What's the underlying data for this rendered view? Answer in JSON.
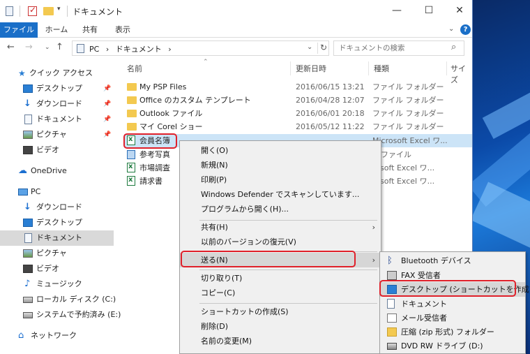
{
  "window": {
    "title": "ドキュメント"
  },
  "ribbon": {
    "tabs": [
      "ファイル",
      "ホーム",
      "共有",
      "表示"
    ]
  },
  "address": {
    "crumbs": [
      "PC",
      "›",
      "ドキュメント",
      "›"
    ],
    "search_placeholder": "ドキュメントの検索"
  },
  "nav": {
    "items": [
      {
        "label": "クイック アクセス",
        "icon": "star-icon"
      },
      {
        "label": "デスクトップ",
        "icon": "desktop-icon"
      },
      {
        "label": "ダウンロード",
        "icon": "download-icon"
      },
      {
        "label": "ドキュメント",
        "icon": "document-icon"
      },
      {
        "label": "ピクチャ",
        "icon": "pictures-icon"
      },
      {
        "label": "ビデオ",
        "icon": "video-icon"
      },
      {
        "label": "OneDrive",
        "icon": "cloud-icon"
      },
      {
        "label": "PC",
        "icon": "pc-icon"
      },
      {
        "label": "ダウンロード",
        "icon": "download-icon"
      },
      {
        "label": "デスクトップ",
        "icon": "desktop-icon"
      },
      {
        "label": "ドキュメント",
        "icon": "document-icon"
      },
      {
        "label": "ピクチャ",
        "icon": "pictures-icon"
      },
      {
        "label": "ビデオ",
        "icon": "video-icon"
      },
      {
        "label": "ミュージック",
        "icon": "music-icon"
      },
      {
        "label": "ローカル ディスク (C:)",
        "icon": "drive-icon"
      },
      {
        "label": "システムで予約済み (E:)",
        "icon": "drive-icon"
      },
      {
        "label": "ネットワーク",
        "icon": "network-icon"
      }
    ]
  },
  "columns": {
    "name": "名前",
    "date": "更新日時",
    "type": "種類",
    "size": "サイズ"
  },
  "files": [
    {
      "name": "My PSP Files",
      "date": "2016/06/15 13:21",
      "type": "ファイル フォルダー",
      "icon": "folder-icon"
    },
    {
      "name": "Office のカスタム テンプレート",
      "date": "2016/04/28 12:07",
      "type": "ファイル フォルダー",
      "icon": "folder-icon"
    },
    {
      "name": "Outlook ファイル",
      "date": "2016/06/01 20:18",
      "type": "ファイル フォルダー",
      "icon": "folder-icon"
    },
    {
      "name": "マイ Corel ショー",
      "date": "2016/05/12 11:22",
      "type": "ファイル フォルダー",
      "icon": "folder-icon"
    },
    {
      "name": "会員名簿",
      "date": "",
      "type": "Microsoft Excel ワ...",
      "icon": "excel-icon"
    },
    {
      "name": "参考写真",
      "date": "",
      "type": "G ファイル",
      "icon": "image-icon"
    },
    {
      "name": "市場調査",
      "date": "",
      "type": "rosoft Excel ワ...",
      "icon": "excel-icon"
    },
    {
      "name": "請求書",
      "date": "",
      "type": "rosoft Excel ワ...",
      "icon": "excel-icon"
    }
  ],
  "context_menu": {
    "items": [
      "開く(O)",
      "新規(N)",
      "印刷(P)",
      "Windows Defender でスキャンしています...",
      "プログラムから開く(H)...",
      "共有(H)",
      "以前のバージョンの復元(V)",
      "送る(N)",
      "切り取り(T)",
      "コピー(C)",
      "ショートカットの作成(S)",
      "削除(D)",
      "名前の変更(M)"
    ]
  },
  "sendto_menu": {
    "items": [
      {
        "label": "Bluetooth デバイス",
        "icon": "bluetooth-icon"
      },
      {
        "label": "FAX 受信者",
        "icon": "fax-icon"
      },
      {
        "label": "デスクトップ (ショートカットを作成)",
        "icon": "desktop-icon"
      },
      {
        "label": "ドキュメント",
        "icon": "document-icon"
      },
      {
        "label": "メール受信者",
        "icon": "mail-icon"
      },
      {
        "label": "圧縮 (zip 形式) フォルダー",
        "icon": "zip-folder-icon"
      },
      {
        "label": "DVD RW ドライブ (D:)",
        "icon": "dvd-drive-icon"
      }
    ]
  }
}
